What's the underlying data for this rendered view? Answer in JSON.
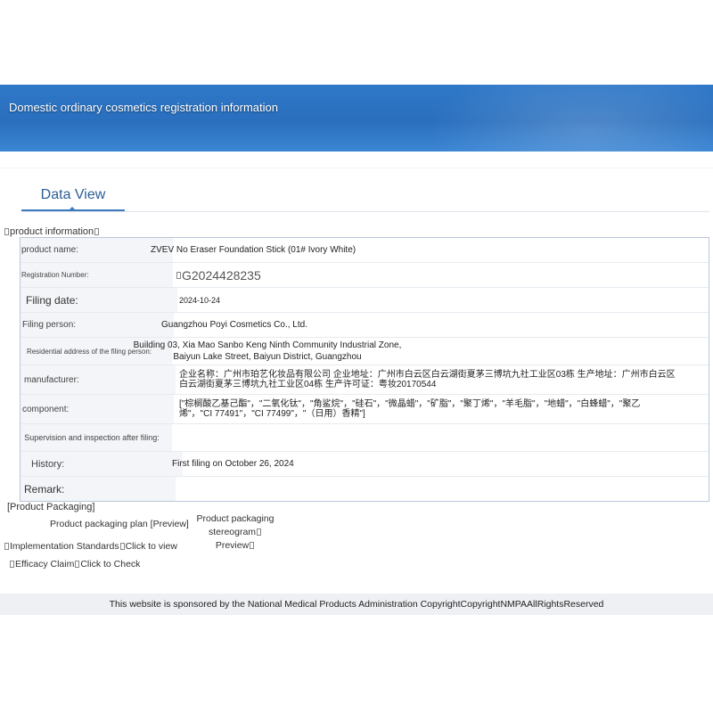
{
  "header": {
    "title": "Domestic ordinary cosmetics registration information"
  },
  "tabs": [
    {
      "label": "Data View",
      "active": true
    }
  ],
  "product_info": {
    "section_title": "product information",
    "rows": [
      {
        "label": "product name:",
        "value": "ZVEV No Eraser Foundation Stick (01# Ivory White)"
      },
      {
        "label": "Registration Number:",
        "value": "G2024428235"
      },
      {
        "label": "Filing date:",
        "value": "2024-10-24"
      },
      {
        "label": "Filing person:",
        "value": "Guangzhou Poyi Cosmetics Co., Ltd."
      },
      {
        "label": "Residential address of the filing person:",
        "value": "Building 03, Xia Mao Sanbo Keng Ninth Community Industrial Zone, Baiyun Lake Street, Baiyun District, Guangzhou"
      },
      {
        "label": "manufacturer:",
        "value": "企业名称：广州市珀艺化妆品有限公司 企业地址：广州市白云区白云湖街夏茅三博坑九社工业区03栋 生产地址：广州市白云区白云湖街夏茅三博坑九社工业区04栋 生产许可证：粤妆20170544"
      },
      {
        "label": "component:",
        "value": "[\"棕榈酸乙基己酯\"，\"二氧化钛\"，\"角鲨烷\"，\"硅石\"，\"微晶蜡\"，\"矿脂\"，\"聚丁烯\"，\"羊毛脂\"，\"地蜡\"，\"白蜂蜡\"，\"聚乙烯\"，\"CI 77491\"，\"CI 77499\"，\"（日用）香精\"]"
      },
      {
        "label": "Supervision and inspection after filing:",
        "value": ""
      },
      {
        "label": "History:",
        "value": "First filing on October 26, 2024"
      },
      {
        "label": "Remark:",
        "value": ""
      }
    ]
  },
  "packaging": {
    "section_title": "[Product Packaging]",
    "plan_label": "Product packaging plan [Preview]",
    "stereogram_label_1": "Product packaging",
    "stereogram_label_2": "stereogram",
    "stereogram_preview": "Preview"
  },
  "links": {
    "standards_label": "Implementation Standards",
    "standards_action": "Click to view",
    "efficacy_label": "Efficacy Claim",
    "efficacy_action": "Click to Check"
  },
  "footer": {
    "text": "This website is sponsored by the National Medical Products Administration CopyrightCopyrightNMPAAllRightsReserved"
  }
}
